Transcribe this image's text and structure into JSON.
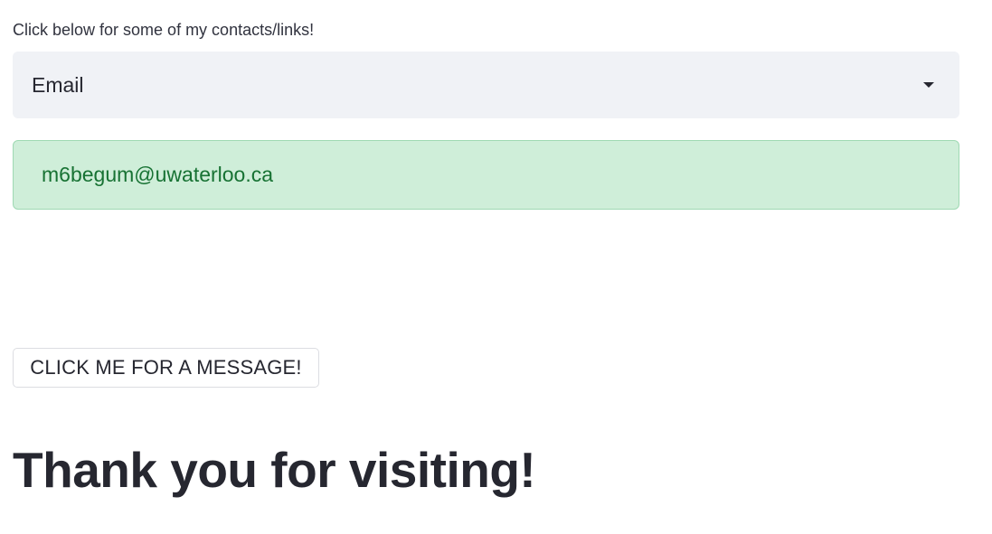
{
  "contacts": {
    "label": "Click below for some of my contacts/links!",
    "selected_option": "Email",
    "dropdown_icon": "caret-down-icon"
  },
  "result": {
    "email": "m6begum@uwaterloo.ca",
    "status_color": "#177233",
    "background_color": "#cfeed9"
  },
  "message_button": {
    "label": "CLICK ME FOR A MESSAGE!"
  },
  "footer": {
    "heading": "Thank you for visiting!"
  }
}
